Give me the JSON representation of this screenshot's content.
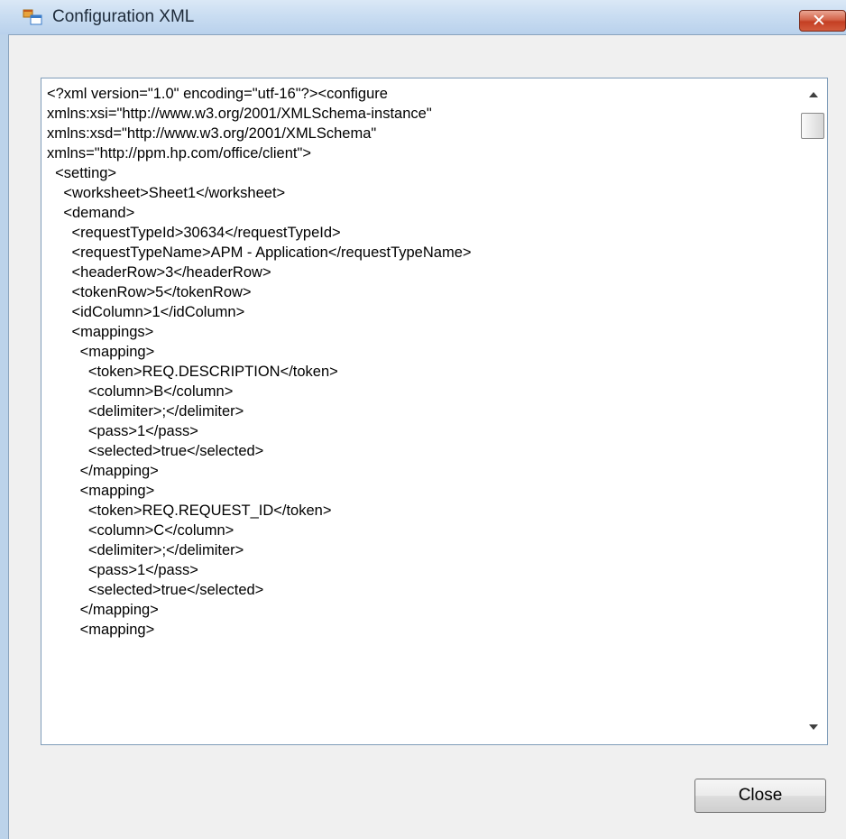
{
  "window": {
    "title": "Configuration XML",
    "close_glyph": "✕",
    "icon": "application-window-icon"
  },
  "xml_editor": {
    "lines": [
      "<?xml version=\"1.0\" encoding=\"utf-16\"?><configure",
      "xmlns:xsi=\"http://www.w3.org/2001/XMLSchema-instance\"",
      "xmlns:xsd=\"http://www.w3.org/2001/XMLSchema\"",
      "xmlns=\"http://ppm.hp.com/office/client\">",
      "  <setting>",
      "    <worksheet>Sheet1</worksheet>",
      "    <demand>",
      "      <requestTypeId>30634</requestTypeId>",
      "      <requestTypeName>APM - Application</requestTypeName>",
      "      <headerRow>3</headerRow>",
      "      <tokenRow>5</tokenRow>",
      "      <idColumn>1</idColumn>",
      "      <mappings>",
      "        <mapping>",
      "          <token>REQ.DESCRIPTION</token>",
      "          <column>B</column>",
      "          <delimiter>;</delimiter>",
      "          <pass>1</pass>",
      "          <selected>true</selected>",
      "        </mapping>",
      "        <mapping>",
      "          <token>REQ.REQUEST_ID</token>",
      "          <column>C</column>",
      "          <delimiter>;</delimiter>",
      "          <pass>1</pass>",
      "          <selected>true</selected>",
      "        </mapping>",
      "        <mapping>"
    ]
  },
  "buttons": {
    "close_label": "Close"
  },
  "colors": {
    "titlebar": "#c8dcf1",
    "dialog_background": "#f0f0f0",
    "close_button_red": "#c43f23"
  }
}
